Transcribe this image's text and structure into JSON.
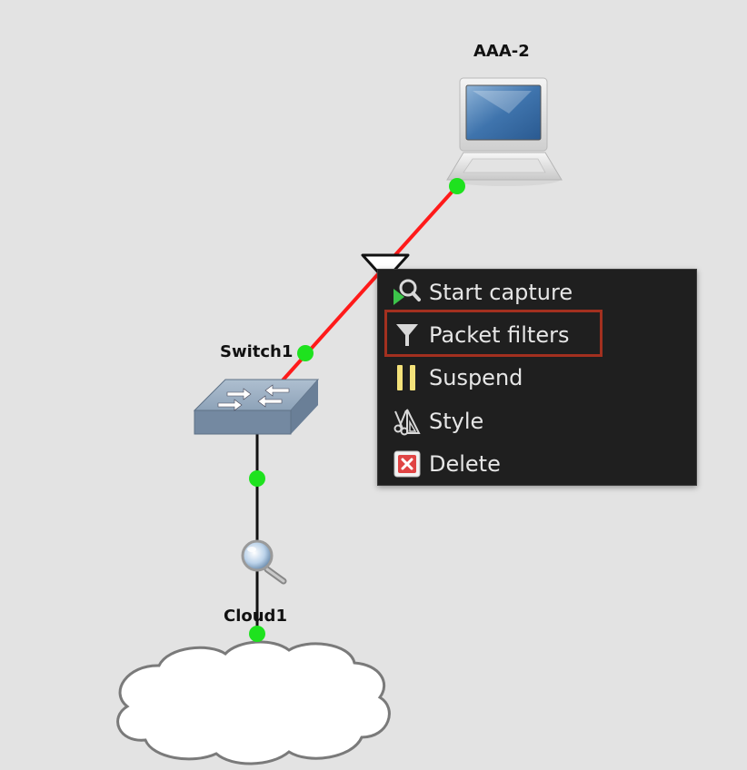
{
  "topology": {
    "nodes": {
      "laptop": {
        "label": "AAA-2",
        "icon": "laptop-icon"
      },
      "switch": {
        "label": "Switch1",
        "icon": "switch-icon"
      },
      "cloud": {
        "label": "Cloud1",
        "icon": "cloud-icon"
      }
    },
    "links": [
      {
        "from": "AAA-2",
        "to": "Switch1",
        "color": "#ff1a1a",
        "status": "filter-indicator"
      },
      {
        "from": "Switch1",
        "to": "Cloud1",
        "color": "#111111",
        "status": "capture-indicator"
      }
    ],
    "colors": {
      "background": "#e3e3e3",
      "port_up": "#1ee21e",
      "menu_background": "#1f1f1f",
      "highlight": "#a3301f"
    }
  },
  "context_menu": {
    "items": [
      {
        "label": "Start capture",
        "icon": "start-capture-icon"
      },
      {
        "label": "Packet filters",
        "icon": "filter-icon",
        "highlighted": true
      },
      {
        "label": "Suspend",
        "icon": "pause-icon"
      },
      {
        "label": "Style",
        "icon": "style-icon"
      },
      {
        "label": "Delete",
        "icon": "delete-icon"
      }
    ]
  }
}
